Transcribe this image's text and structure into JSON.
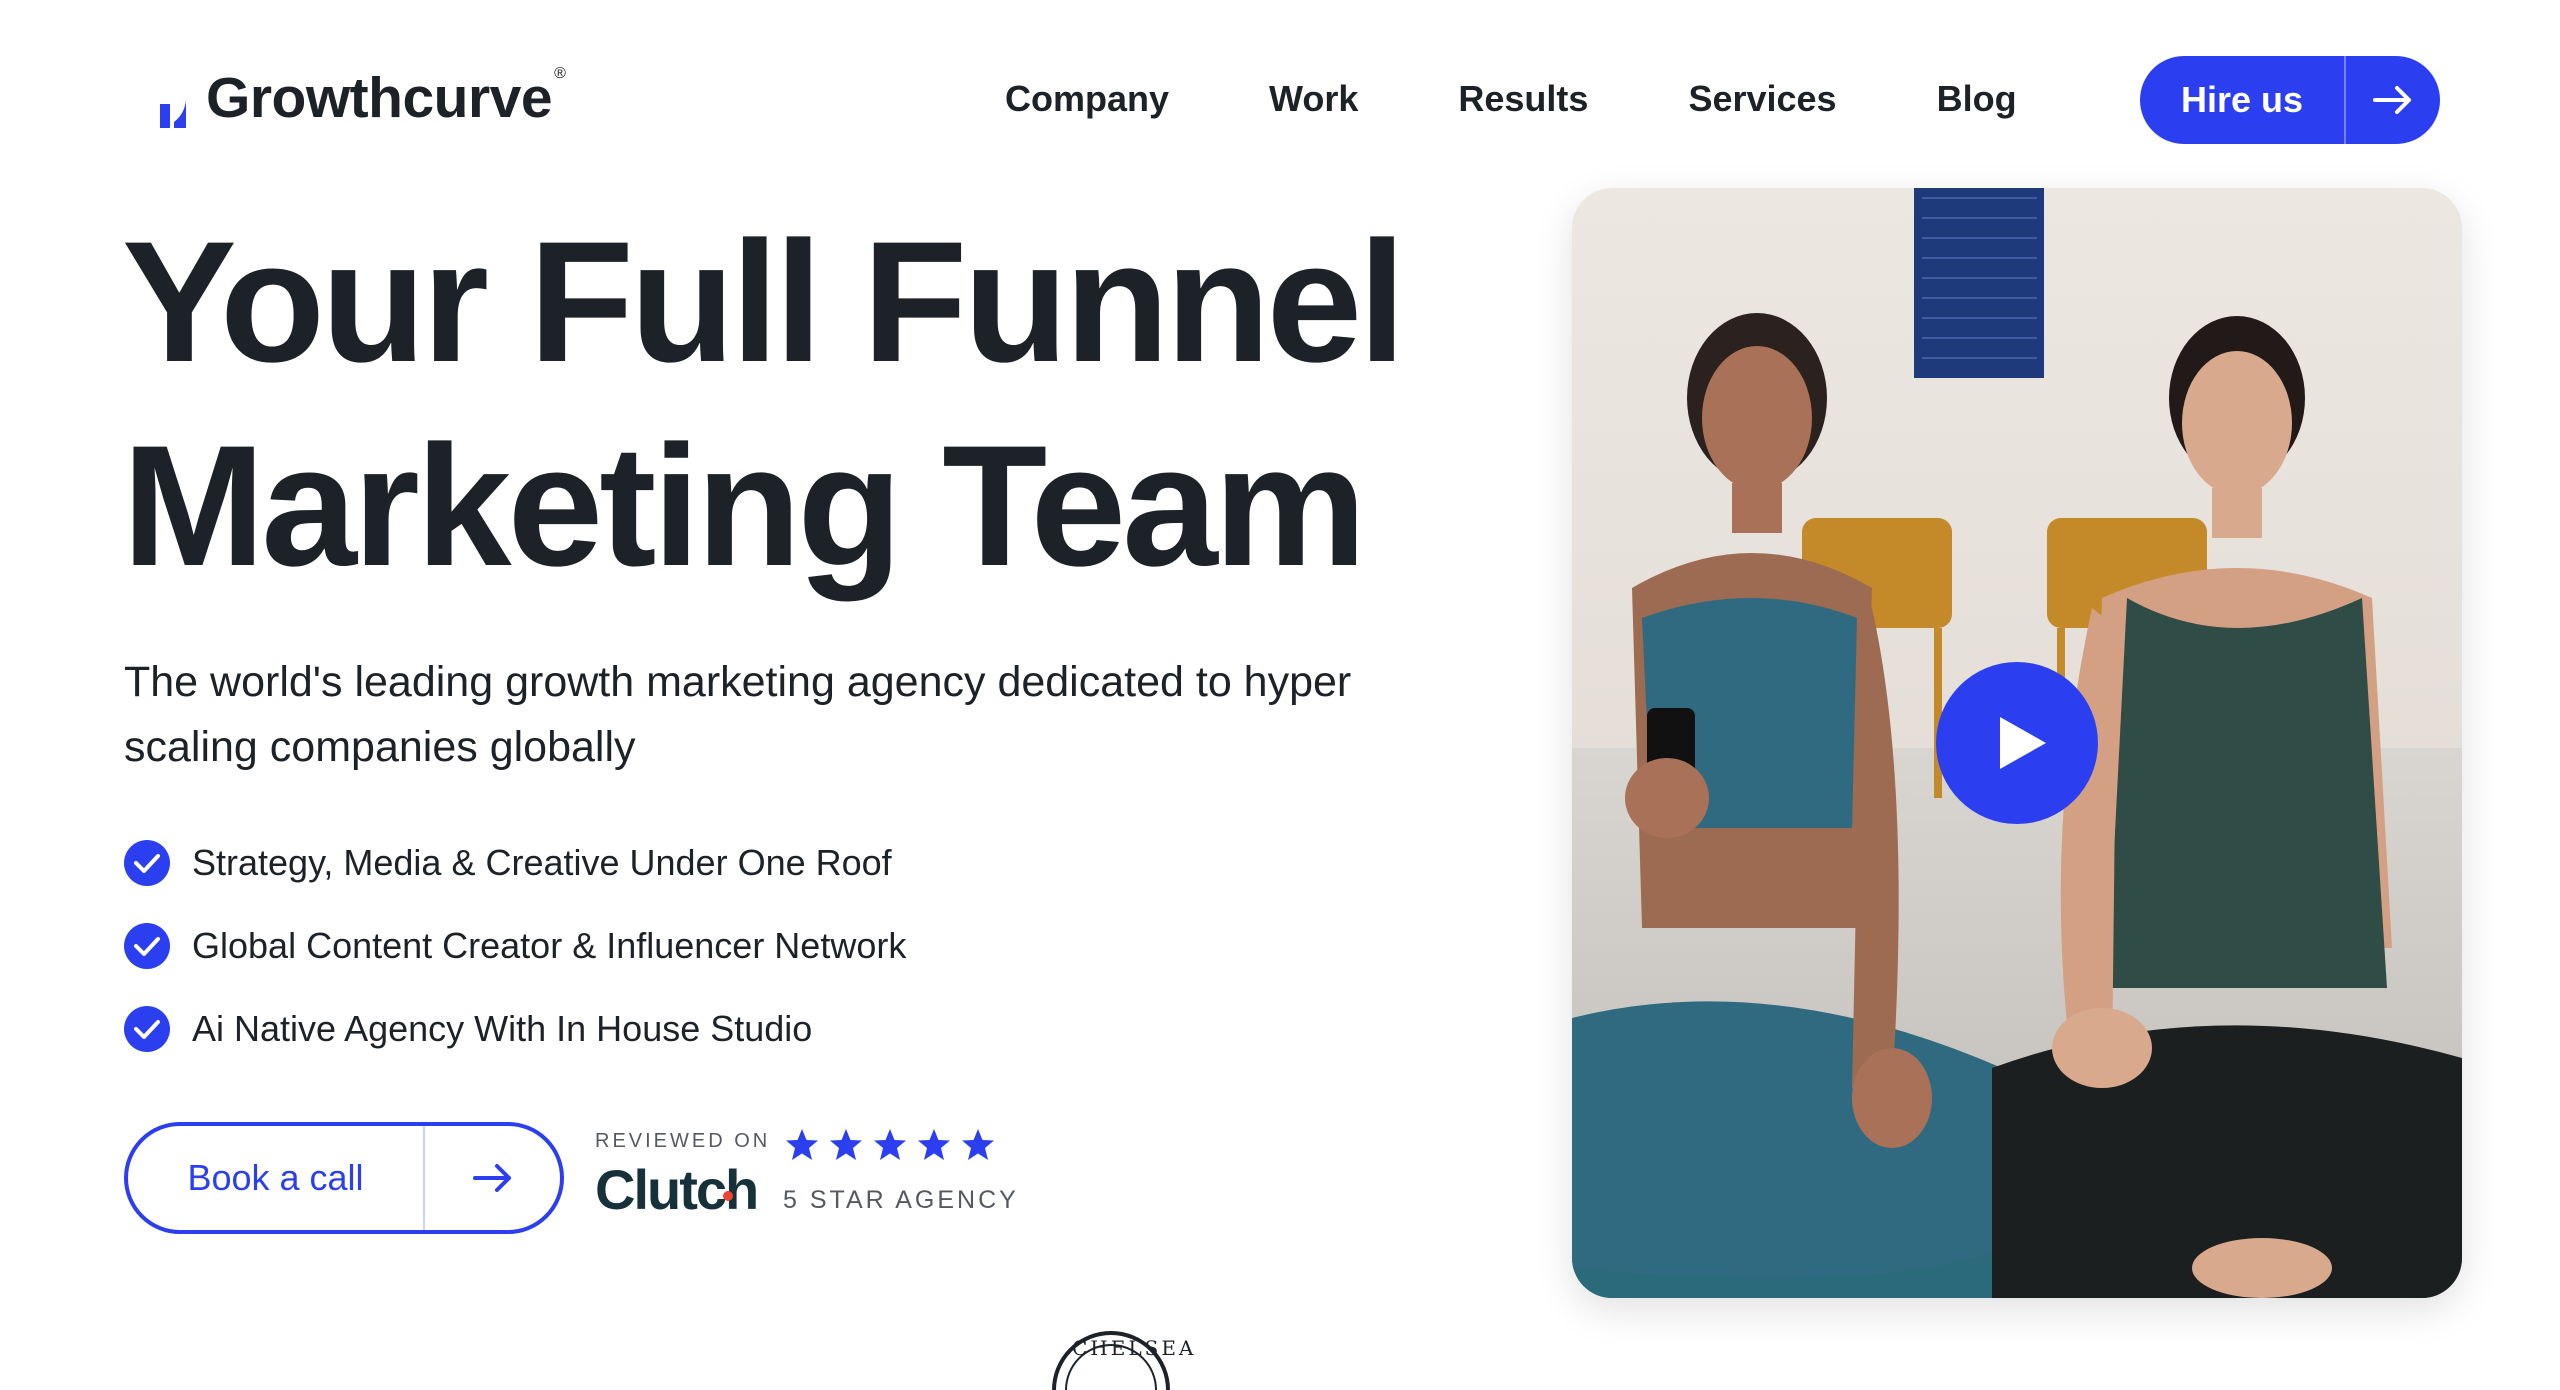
{
  "brand": {
    "name": "Growthcurve",
    "reg_mark": "®",
    "primary_color": "#2b3ff0",
    "text_color": "#1d2228"
  },
  "nav": {
    "items": [
      {
        "label": "Company"
      },
      {
        "label": "Work"
      },
      {
        "label": "Results"
      },
      {
        "label": "Services"
      },
      {
        "label": "Blog"
      }
    ],
    "cta": {
      "label": "Hire us",
      "icon": "arrow-right-icon"
    }
  },
  "hero": {
    "title_line1": "Your Full Funnel",
    "title_line2": "Marketing Team",
    "subtitle": "The world's leading growth marketing agency dedicated to hyper scaling companies globally",
    "features": [
      {
        "text": "Strategy, Media & Creative Under One Roof",
        "icon": "check-circle-icon"
      },
      {
        "text": "Global Content Creator & Influencer Network",
        "icon": "check-circle-icon"
      },
      {
        "text": "Ai Native Agency With In House Studio",
        "icon": "check-circle-icon"
      }
    ],
    "book_call": {
      "label": "Book a call",
      "icon": "arrow-right-icon"
    }
  },
  "review": {
    "reviewed_on": "REVIEWED ON",
    "platform": "Clutch",
    "rating": 5,
    "rating_max": 5,
    "badge": "5 STAR AGENCY"
  },
  "video": {
    "play_icon": "play-icon"
  },
  "partner_logo_peek": {
    "text": "CHELSEA"
  }
}
